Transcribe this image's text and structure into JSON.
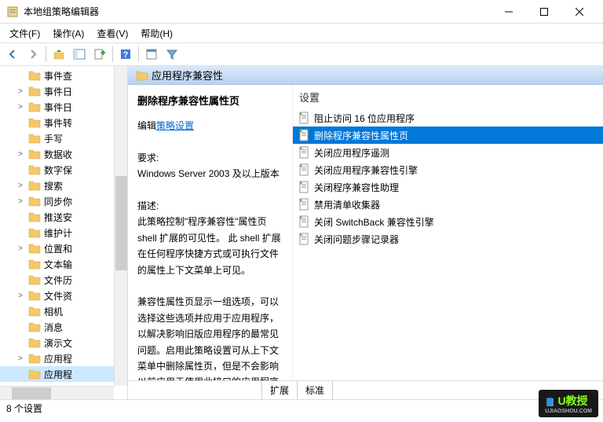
{
  "window": {
    "title": "本地组策略编辑器"
  },
  "menu": {
    "file": "文件(F)",
    "action": "操作(A)",
    "view": "查看(V)",
    "help": "帮助(H)"
  },
  "tree": {
    "items": [
      {
        "label": "事件查",
        "expand": "",
        "sel": false
      },
      {
        "label": "事件日",
        "expand": ">",
        "sel": false
      },
      {
        "label": "事件日",
        "expand": ">",
        "sel": false
      },
      {
        "label": "事件转",
        "expand": "",
        "sel": false
      },
      {
        "label": "手写",
        "expand": "",
        "sel": false
      },
      {
        "label": "数据收",
        "expand": ">",
        "sel": false
      },
      {
        "label": "数字保",
        "expand": "",
        "sel": false
      },
      {
        "label": "搜索",
        "expand": ">",
        "sel": false
      },
      {
        "label": "同步你",
        "expand": ">",
        "sel": false
      },
      {
        "label": "推送安",
        "expand": "",
        "sel": false
      },
      {
        "label": "维护计",
        "expand": "",
        "sel": false
      },
      {
        "label": "位置和",
        "expand": ">",
        "sel": false
      },
      {
        "label": "文本输",
        "expand": "",
        "sel": false
      },
      {
        "label": "文件历",
        "expand": "",
        "sel": false
      },
      {
        "label": "文件资",
        "expand": ">",
        "sel": false
      },
      {
        "label": "相机",
        "expand": "",
        "sel": false
      },
      {
        "label": "消息",
        "expand": "",
        "sel": false
      },
      {
        "label": "演示文",
        "expand": "",
        "sel": false
      },
      {
        "label": "应用程",
        "expand": ">",
        "sel": false
      },
      {
        "label": "应用程",
        "expand": "",
        "sel": true
      }
    ]
  },
  "header": {
    "title": "应用程序兼容性"
  },
  "detail": {
    "title": "删除程序兼容性属性页",
    "edit_prefix": "编辑",
    "edit_link": "策略设置",
    "req_label": "要求:",
    "req_value": "Windows Server 2003 及以上版本",
    "desc_label": "描述:",
    "desc_p1": "此策略控制\"程序兼容性\"属性页 shell 扩展的可见性。 此 shell 扩展在任何程序快捷方式或可执行文件的属性上下文菜单上可见。",
    "desc_p2": "兼容性属性页显示一组选项，可以选择这些选项并应用于应用程序，以解决影响旧版应用程序的最常见问题。启用此策略设置可从上下文菜单中删除属性页，但是不会影响以前应用于使用此接口的应用程序的兼容性设置。"
  },
  "settings": {
    "header": "设置",
    "items": [
      {
        "label": "阻止访问 16 位应用程序",
        "sel": false
      },
      {
        "label": "删除程序兼容性属性页",
        "sel": true
      },
      {
        "label": "关闭应用程序遥测",
        "sel": false
      },
      {
        "label": "关闭应用程序兼容性引擎",
        "sel": false
      },
      {
        "label": "关闭程序兼容性助理",
        "sel": false
      },
      {
        "label": "禁用清单收集器",
        "sel": false
      },
      {
        "label": "关闭 SwitchBack 兼容性引擎",
        "sel": false
      },
      {
        "label": "关闭问题步骤记录器",
        "sel": false
      }
    ]
  },
  "tabs": {
    "extended": "扩展",
    "standard": "标准"
  },
  "status": {
    "text": "8 个设置"
  },
  "watermark": {
    "text": "U教授",
    "sub": "UJIAOSHOU.COM"
  }
}
